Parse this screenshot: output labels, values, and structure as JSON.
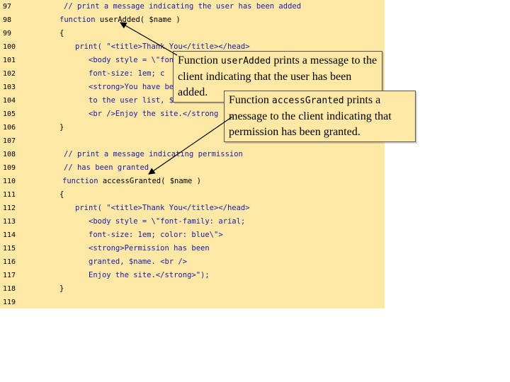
{
  "lines": [
    {
      "num": "97",
      "indent": 90,
      "parts": [
        {
          "t": "// print a message indicating the user has been added",
          "c": "c-comment"
        }
      ]
    },
    {
      "num": "98",
      "indent": 84,
      "parts": [
        {
          "t": "function ",
          "c": "c-kw"
        },
        {
          "t": "userAdded( $name )",
          "c": "c-black"
        }
      ]
    },
    {
      "num": "99",
      "indent": 84,
      "parts": [
        {
          "t": "{",
          "c": "c-black"
        }
      ]
    },
    {
      "num": "100",
      "indent": 106,
      "parts": [
        {
          "t": "print( ",
          "c": "c-kw"
        },
        {
          "t": "\"<title>Thank You</title></head>",
          "c": "c-str"
        }
      ]
    },
    {
      "num": "101",
      "indent": 125,
      "parts": [
        {
          "t": "<body style = \\\"font",
          "c": "c-str"
        }
      ]
    },
    {
      "num": "102",
      "indent": 125,
      "parts": [
        {
          "t": "font-size: 1em; c",
          "c": "c-str"
        }
      ]
    },
    {
      "num": "103",
      "indent": 125,
      "parts": [
        {
          "t": "<strong>You have been added",
          "c": "c-str"
        }
      ]
    },
    {
      "num": "104",
      "indent": 125,
      "parts": [
        {
          "t": "to the user list, $name.",
          "c": "c-str"
        }
      ]
    },
    {
      "num": "105",
      "indent": 125,
      "parts": [
        {
          "t": "<br />Enjoy the site.</strong",
          "c": "c-str"
        }
      ]
    },
    {
      "num": "106",
      "indent": 84,
      "parts": [
        {
          "t": "}",
          "c": "c-black"
        }
      ]
    },
    {
      "num": "107",
      "indent": 84,
      "parts": [
        {
          "t": "",
          "c": "c-black"
        }
      ]
    },
    {
      "num": "108",
      "indent": 90,
      "parts": [
        {
          "t": "// print a message indicating permission",
          "c": "c-comment"
        }
      ]
    },
    {
      "num": "109",
      "indent": 90,
      "parts": [
        {
          "t": "// has been granted",
          "c": "c-comment"
        }
      ]
    },
    {
      "num": "110",
      "indent": 88,
      "parts": [
        {
          "t": "function ",
          "c": "c-kw"
        },
        {
          "t": "accessGranted( $name )",
          "c": "c-black"
        }
      ]
    },
    {
      "num": "111",
      "indent": 84,
      "parts": [
        {
          "t": "{",
          "c": "c-black"
        }
      ]
    },
    {
      "num": "112",
      "indent": 106,
      "parts": [
        {
          "t": "print( ",
          "c": "c-kw"
        },
        {
          "t": "\"<title>Thank You</title></head>",
          "c": "c-str"
        }
      ]
    },
    {
      "num": "113",
      "indent": 125,
      "parts": [
        {
          "t": "<body style = \\\"font-family: arial;",
          "c": "c-str"
        }
      ]
    },
    {
      "num": "114",
      "indent": 125,
      "parts": [
        {
          "t": "font-size: 1em; color: blue\\\">",
          "c": "c-str"
        }
      ]
    },
    {
      "num": "115",
      "indent": 125,
      "parts": [
        {
          "t": "<strong>Permission has been",
          "c": "c-str"
        }
      ]
    },
    {
      "num": "116",
      "indent": 125,
      "parts": [
        {
          "t": "granted, $name. <br />",
          "c": "c-str"
        }
      ]
    },
    {
      "num": "117",
      "indent": 125,
      "parts": [
        {
          "t": "Enjoy the site.</strong>\");",
          "c": "c-str"
        }
      ]
    },
    {
      "num": "118",
      "indent": 84,
      "parts": [
        {
          "t": "}",
          "c": "c-black"
        }
      ]
    },
    {
      "num": "119",
      "indent": 84,
      "parts": [
        {
          "t": "",
          "c": "c-black"
        }
      ]
    }
  ],
  "callouts": {
    "user_added": {
      "prefix": "Function ",
      "mono": "userAdded",
      "suffix": " prints a message to the client indicating that the user has been added."
    },
    "access_granted": {
      "prefix": "Function ",
      "mono": "accessGranted",
      "suffix": " prints a message to the client indicating that permission has been granted."
    }
  }
}
